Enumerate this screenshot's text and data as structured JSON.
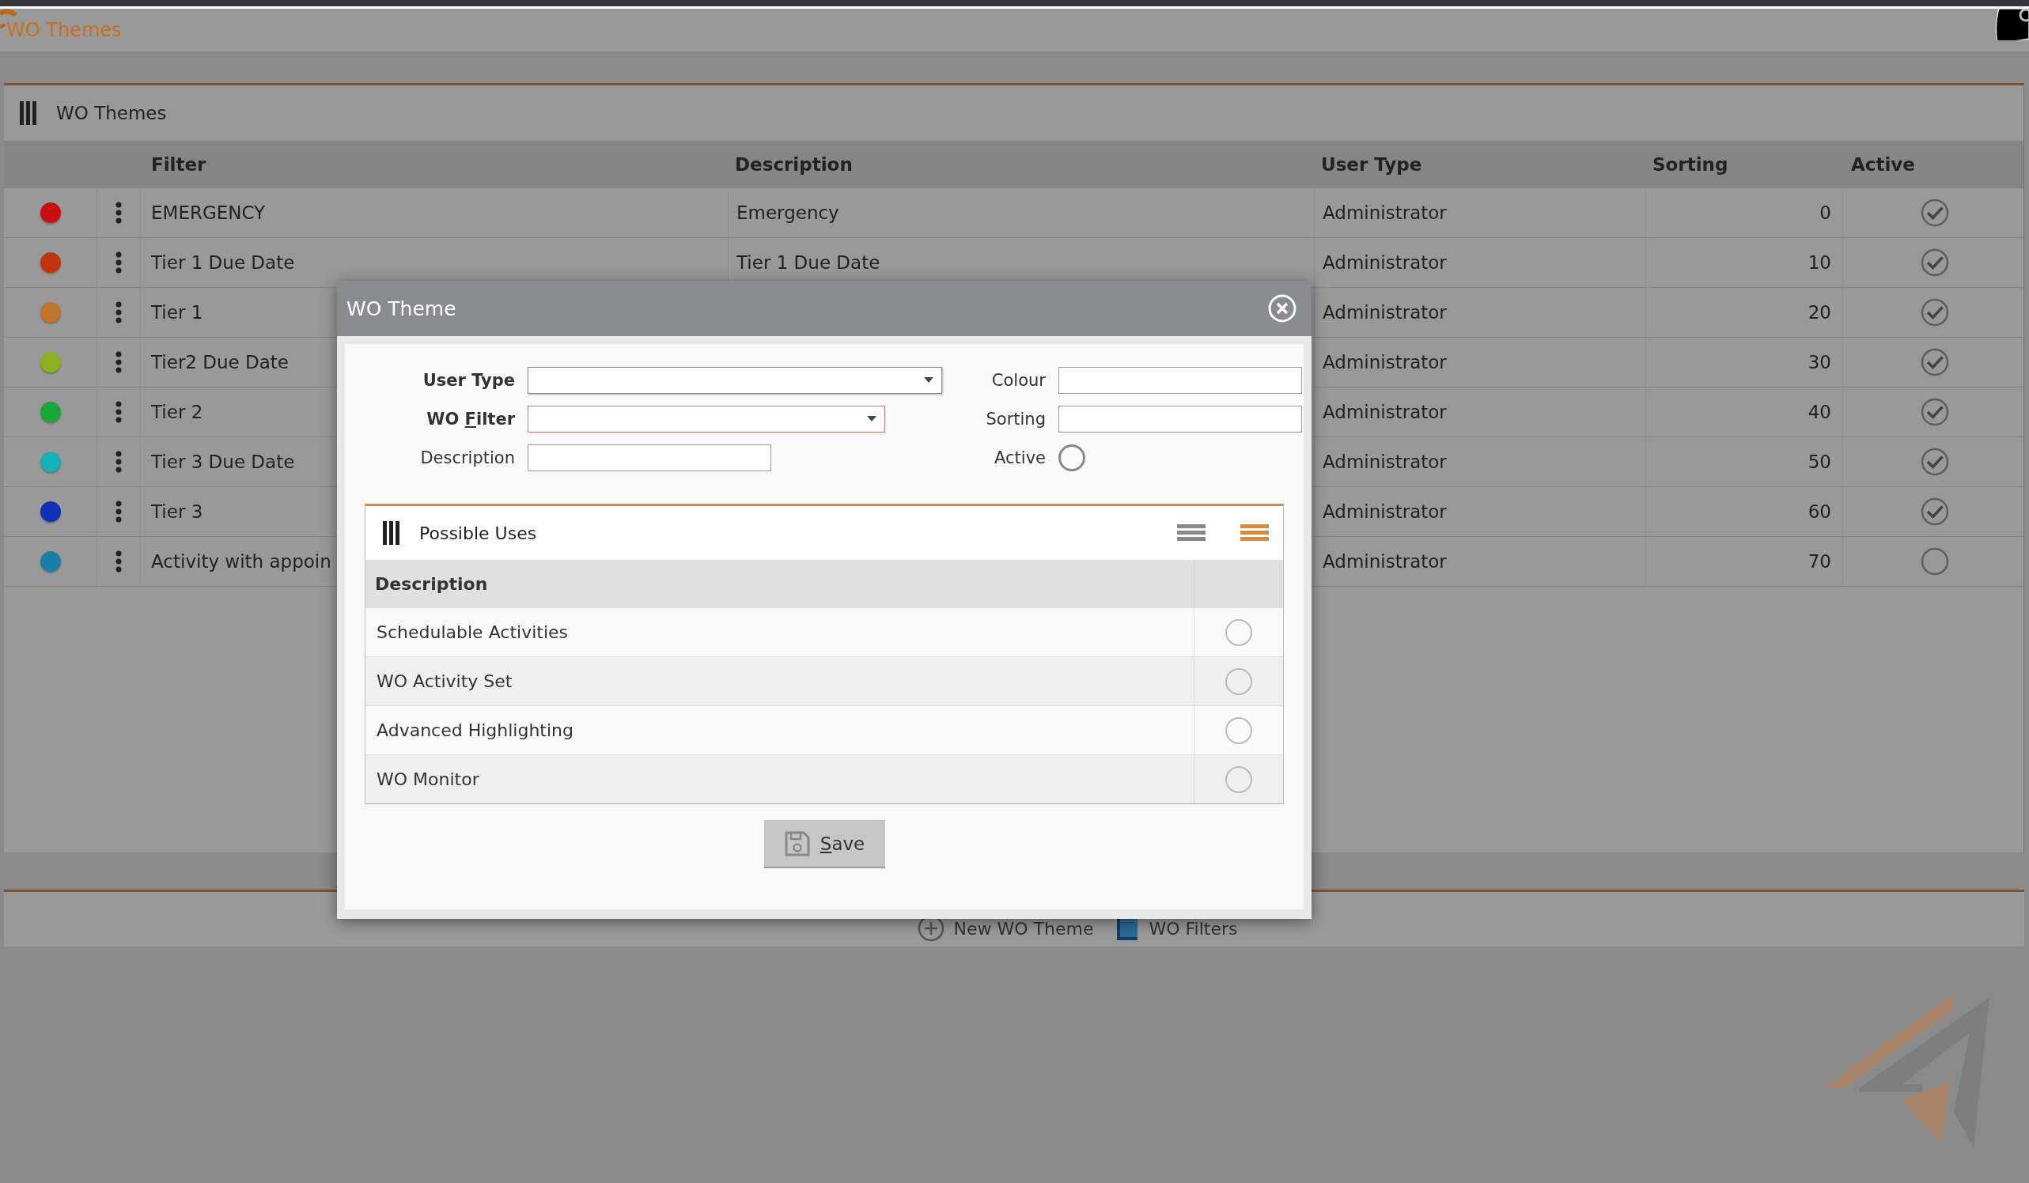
{
  "app": {
    "title": "WO Themes"
  },
  "panel": {
    "title": "WO Themes",
    "columns": [
      "Filter",
      "Description",
      "User Type",
      "Sorting",
      "Active"
    ],
    "rows": [
      {
        "color": "#c80f0f",
        "filter": "EMERGENCY",
        "description": "Emergency",
        "user_type": "Administrator",
        "sorting": "0",
        "active": true
      },
      {
        "color": "#c0340c",
        "filter": "Tier 1 Due Date",
        "description": "Tier 1 Due Date",
        "user_type": "Administrator",
        "sorting": "10",
        "active": true
      },
      {
        "color": "#c0742e",
        "filter": "Tier 1",
        "user_type": "Administrator",
        "sorting": "20",
        "active": true
      },
      {
        "color": "#8cb020",
        "filter": "Tier2 Due Date",
        "user_type": "Administrator",
        "sorting": "30",
        "active": true
      },
      {
        "color": "#18a838",
        "filter": "Tier 2",
        "user_type": "Administrator",
        "sorting": "40",
        "active": true
      },
      {
        "color": "#18b0b8",
        "filter": "Tier 3 Due Date",
        "user_type": "Administrator",
        "sorting": "50",
        "active": true
      },
      {
        "color": "#1030b8",
        "filter": "Tier 3",
        "user_type": "Administrator",
        "sorting": "60",
        "active": true
      },
      {
        "color": "#1880a8",
        "filter": "Activity with appoin",
        "user_type": "Administrator",
        "sorting": "70",
        "active": false
      }
    ]
  },
  "footer": {
    "buttons": [
      {
        "label": "New WO Theme",
        "kind": "add"
      },
      {
        "label": "WO Filters",
        "kind": "filters"
      }
    ]
  },
  "modal": {
    "title": "WO Theme",
    "left_fields": [
      {
        "label": "User Type",
        "kind": "select",
        "required": true,
        "invalid": false
      },
      {
        "label": "WO ",
        "access_key": "F",
        "label_rest": "ilter",
        "kind": "select",
        "required": true,
        "invalid": true
      },
      {
        "label": "Description",
        "kind": "text",
        "required": false,
        "invalid": false
      }
    ],
    "right_fields": [
      {
        "label": "Colour",
        "kind": "text"
      },
      {
        "label": "Sorting",
        "kind": "text"
      },
      {
        "label": "Active",
        "kind": "radio",
        "checked": false
      }
    ],
    "uses": {
      "title": "Possible Uses",
      "views": [
        {
          "selected": false
        },
        {
          "selected": true
        }
      ],
      "column": "Description",
      "rows": [
        {
          "label": "Schedulable Activities",
          "checked": false
        },
        {
          "label": "WO Activity Set",
          "checked": false
        },
        {
          "label": "Advanced Highlighting",
          "checked": false
        },
        {
          "label": "WO Monitor",
          "checked": false
        }
      ]
    },
    "save": {
      "access_key": "S",
      "label_rest": "ave"
    }
  }
}
